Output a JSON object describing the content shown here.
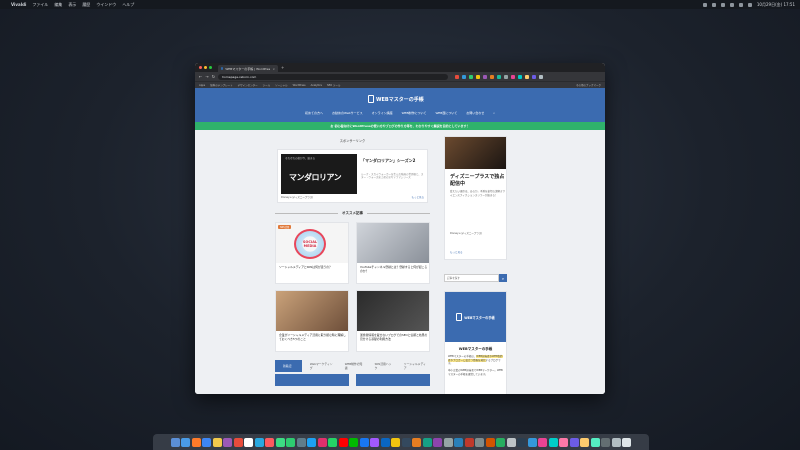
{
  "menubar": {
    "app_name": "Vivaldi",
    "menus": [
      "ファイル",
      "編集",
      "表示",
      "履歴",
      "ウインドウ",
      "ヘルプ"
    ],
    "clock": "10月29日(金) 17:51"
  },
  "browser": {
    "tab_title": "WEBマスターの手帳 | WordPressの使い方",
    "url": "homepage-reborn.com",
    "bookmarks": [
      "Apps",
      "無料のテンプレート",
      "デザインセンター",
      "ツール",
      "ソーシャル",
      "WordPress",
      "Analytics",
      "SEO ツール",
      "その他のブックマーク"
    ]
  },
  "site": {
    "logo_text": "WEBマスターの手帳",
    "nav": [
      "初めての方へ",
      "お勧めのWebサービス",
      "オンライン講座",
      "WEB制作について",
      "WEB歴について",
      "お問い合わせ"
    ],
    "banner": "お 初心者向けにWordPressの使い方やブログの作り方等を、わかりやすく解説を目的としています！"
  },
  "main": {
    "sponsor_label": "スポンサーリンク",
    "ad": {
      "title": "「マンダロリアン」シーズン2",
      "desc": "ルーク・スカイウォーカーを生んだ映画の世界観と、スター・ウォーズ史上初の実写ドラマシリーズ",
      "footer": "Disney+(ディズニープラス)",
      "more": "もっと見る",
      "logo": "マンダロリアン",
      "small": "それぞれの旅が今、始まる"
    },
    "section_title": "オススメ記事",
    "articles": [
      {
        "tag": "SNS活用",
        "title": "ソーシャルメディアとSNSは何が違うの？",
        "badge": "SOCIAL MEDIA"
      },
      {
        "tag": "",
        "title": "YouTubeチャンネル登録とは？登録すると何が起こるのか？"
      },
      {
        "tag": "",
        "title": "企業がソーシャルメディア活用に取り組む時に理解しておくべき5つのこと"
      },
      {
        "tag": "",
        "title": "運営者情報を載せないブログでのSEOと信頼と効果の見分ける基礎の利用方法"
      }
    ],
    "tabs": [
      "新着記事",
      "Webマーケティング",
      "WEB制作の知識",
      "SNS活用ハック",
      "ソーシャルメディア"
    ]
  },
  "sidebar": {
    "ad": {
      "title": "ディズニープラスで独占配信中",
      "desc": "変えたい運命は、あるか。予測を裏切る謎解きサイエンスフィクションスリラーが始まる！",
      "footer": "Disney+(ディズニープラス)",
      "more": "もっと見る"
    },
    "search_placeholder": "記事を探す",
    "profile": {
      "title": "WEBマスターの手帳",
      "desc_1": "WEBマスターの手帳は、",
      "desc_hl": "WEB担当者やWEB制作者やブロガーに役立つ情報を発信",
      "desc_2": "するブログです。",
      "desc_3": "中小企業のWEB担当者でWEBマーケター。WEBマスターの手帳を運営しています。"
    }
  },
  "dock_colors": [
    "#5b8fd6",
    "#4a9be6",
    "#ff7b2a",
    "#3d86f5",
    "#f2c94c",
    "#9b59b6",
    "#e74c3c",
    "#ffffff",
    "#29a8e0",
    "#ff5a5f",
    "#3ddc84",
    "#2ecc71",
    "#607d8b",
    "#1da1f2",
    "#e1306c",
    "#25d366",
    "#ff0000",
    "#00b900",
    "#1877f2",
    "#a259ff",
    "#0a66c2",
    "#f1c40f",
    "#34495e",
    "#e67e22",
    "#16a085",
    "#8e44ad",
    "#95a5a6",
    "#2980b9",
    "#c0392b",
    "#7f8c8d",
    "#d35400",
    "#27ae60",
    "#bdc3c7",
    "#2c3e50",
    "#3498db",
    "#e84393",
    "#00cec9",
    "#fd79a8",
    "#6c5ce7",
    "#fdcb6e",
    "#55efc4",
    "#636e72",
    "#b2bec3",
    "#dfe6e9"
  ]
}
